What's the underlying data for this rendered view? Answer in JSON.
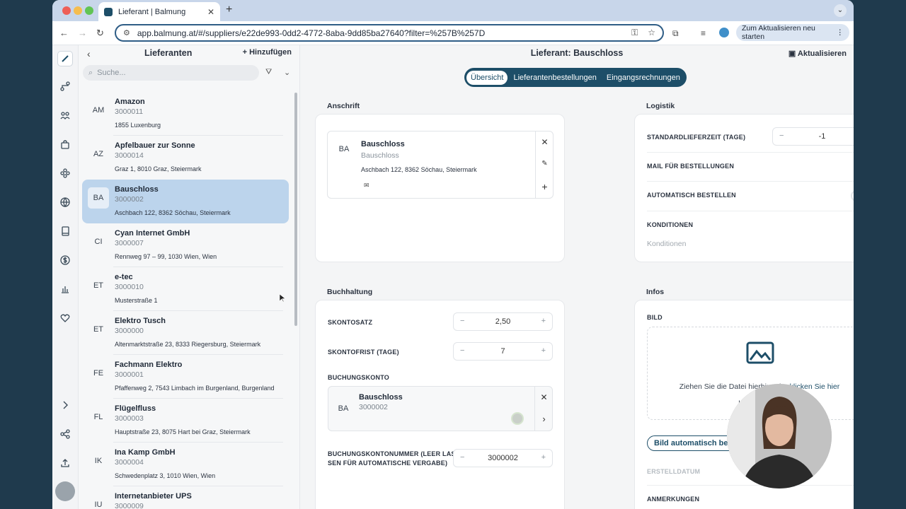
{
  "browser": {
    "tab_title": "Lieferant | Balmung",
    "url": "app.balmung.at/#/suppliers/e22de993-0dd2-4772-8aba-9dd85ba27640?filter=%257B%257D",
    "update_button": "Zum Aktualisieren neu starten"
  },
  "sidebar_list": {
    "title": "Lieferanten",
    "add_label": "Hinzufügen",
    "search_placeholder": "Suche...",
    "items": [
      {
        "abbr": "AM",
        "name": "Amazon",
        "number": "3000011",
        "address": "1855 Luxenburg",
        "selected": false
      },
      {
        "abbr": "AZ",
        "name": "Apfelbauer zur Sonne",
        "number": "3000014",
        "address": "Graz 1, 8010 Graz, Steiermark",
        "selected": false
      },
      {
        "abbr": "BA",
        "name": "Bauschloss",
        "number": "3000002",
        "address": "Aschbach 122, 8362 Söchau, Steiermark",
        "selected": true
      },
      {
        "abbr": "CI",
        "name": "Cyan Internet GmbH",
        "number": "3000007",
        "address": "Rennweg 97 – 99, 1030 Wien, Wien",
        "selected": false
      },
      {
        "abbr": "ET",
        "name": "e-tec",
        "number": "3000010",
        "address": "Musterstraße 1",
        "selected": false
      },
      {
        "abbr": "ET",
        "name": "Elektro Tusch",
        "number": "3000000",
        "address": "Altenmarktstraße 23, 8333 Riegersburg, Steiermark",
        "selected": false
      },
      {
        "abbr": "FE",
        "name": "Fachmann Elektro",
        "number": "3000001",
        "address": "Pfaffenweg 2, 7543 Limbach im Burgenland, Burgenland",
        "selected": false
      },
      {
        "abbr": "FL",
        "name": "Flügelfluss",
        "number": "3000003",
        "address": "Hauptstraße 23, 8075 Hart bei Graz, Steiermark",
        "selected": false
      },
      {
        "abbr": "IK",
        "name": "Ina Kamp GmbH",
        "number": "3000004",
        "address": "Schwedenplatz 3, 1010 Wien, Wien",
        "selected": false
      },
      {
        "abbr": "IU",
        "name": "Internetanbieter UPS",
        "number": "3000009",
        "address": "",
        "selected": false
      }
    ]
  },
  "main": {
    "title": "Lieferant: Bauschloss",
    "refresh_label": "Aktualisieren",
    "tabs": [
      "Übersicht",
      "Lieferantenbestellungen",
      "Eingangsrechnungen"
    ],
    "active_tab": "Übersicht",
    "anschrift": {
      "label": "Anschrift",
      "abbr": "BA",
      "name": "Bauschloss",
      "subname": "Bauschloss",
      "address": "Aschbach 122, 8362 Söchau, Steiermark"
    },
    "logistik": {
      "label": "Logistik",
      "lieferzeit_label": "STANDARDLIEFERZEIT (TAGE)",
      "lieferzeit_value": "-1",
      "mail_label": "MAIL FÜR BESTELLUNGEN",
      "auto_label": "AUTOMATISCH BESTELLEN",
      "auto_on": false,
      "konditionen_label": "KONDITIONEN",
      "konditionen_placeholder": "Konditionen"
    },
    "buchhaltung": {
      "label": "Buchhaltung",
      "skontosatz_label": "SKONTOSATZ",
      "skontosatz_value": "2,50",
      "skontofrist_label": "SKONTOFRIST (TAGE)",
      "skontofrist_value": "7",
      "buchungskonto_label": "BUCHUNGSKONTO",
      "konto_abbr": "BA",
      "konto_name": "Bauschloss",
      "konto_number": "3000002",
      "kontonummer_label_1": "BUCHUNGSKONTONUMMER (LEER LAS-",
      "kontonummer_label_2": "SEN FÜR AUTOMATISCHE VERGABE)",
      "kontonummer_value": "3000002"
    },
    "infos": {
      "label": "Infos",
      "bild_label": "BILD",
      "drop_text_1": "Ziehen Sie die Datei hierhin oder",
      "drop_link": "klicken Sie hier",
      "drop_text_2": "hochzuladen",
      "autofill_button": "Bild automatisch befüllen",
      "erstelldatum_label": "ERSTELLDATUM",
      "anmerkungen_label": "ANMERKUNGEN"
    }
  },
  "colors": {
    "accent": "#1d4e68",
    "selected_row": "#bcd4ec",
    "desktop": "#1f3a4d"
  }
}
